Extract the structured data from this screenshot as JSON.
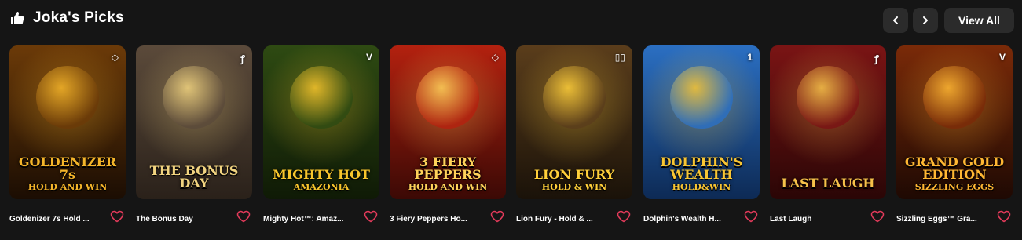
{
  "header": {
    "title": "Joka's Picks",
    "view_all_label": "View All"
  },
  "games": [
    {
      "caption": "Goldenizer 7s Hold ...",
      "logo_line1": "GOLDENIZER 7s",
      "logo_line2": "HOLD AND WIN",
      "badge": "◇",
      "bg_top": "#6b3a08",
      "bg_bottom": "#1b0d03",
      "accent": "#f5b52a"
    },
    {
      "caption": "The Bonus Day",
      "logo_line1": "THE BONUS DAY",
      "logo_line2": "",
      "badge": "ꝭ",
      "bg_top": "#5b4a3a",
      "bg_bottom": "#2a211a",
      "accent": "#f2d480"
    },
    {
      "caption": "Mighty Hot™: Amaz...",
      "logo_line1": "MIGHTY HOT",
      "logo_line2": "AMAZONIA",
      "badge": "V",
      "bg_top": "#2e4a12",
      "bg_bottom": "#0f1a06",
      "accent": "#f7c52c"
    },
    {
      "caption": "3 Fiery Peppers Ho...",
      "logo_line1": "3 FIERY PEPPERS",
      "logo_line2": "HOLD AND WIN",
      "badge": "◇",
      "bg_top": "#b3210f",
      "bg_bottom": "#3b0905",
      "accent": "#ffd25a"
    },
    {
      "caption": "Lion Fury - Hold & ...",
      "logo_line1": "LION FURY",
      "logo_line2": "HOLD & WIN",
      "badge": "▯▯",
      "bg_top": "#5a3d1b",
      "bg_bottom": "#1a1209",
      "accent": "#ffcf3a"
    },
    {
      "caption": "Dolphin's Wealth H...",
      "logo_line1": "DOLPHIN'S WEALTH",
      "logo_line2": "HOLD&WIN",
      "badge": "1",
      "bg_top": "#2b6fc2",
      "bg_bottom": "#0d2a55",
      "accent": "#f8c533"
    },
    {
      "caption": "Last Laugh",
      "logo_line1": "LAST LAUGH",
      "logo_line2": "",
      "badge": "ꝭ",
      "bg_top": "#7a1414",
      "bg_bottom": "#2a0606",
      "accent": "#f6c24a"
    },
    {
      "caption": "Sizzling Eggs™ Gra...",
      "logo_line1": "GRAND GOLD EDITION",
      "logo_line2": "SIZZLING EGGS",
      "badge": "V",
      "bg_top": "#7a2a08",
      "bg_bottom": "#1e0903",
      "accent": "#ffb733"
    }
  ],
  "colors": {
    "page_bg": "#151515",
    "button_bg": "#2b2b2b",
    "heart": "#e23a5a"
  }
}
